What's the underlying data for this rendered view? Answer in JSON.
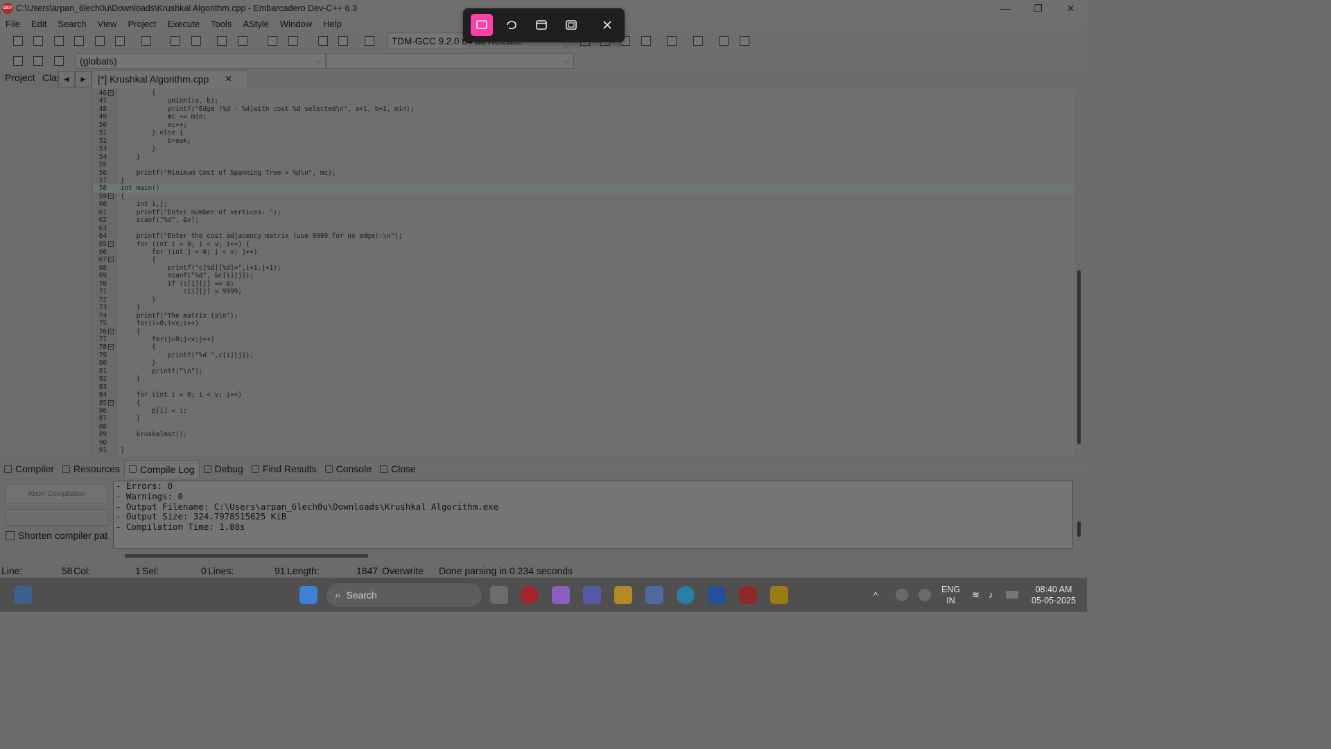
{
  "window": {
    "title": "C:\\Users\\arpan_6lech0u\\Downloads\\Krushkal Algorithm.cpp - Embarcadero Dev-C++ 6.3",
    "logo_text": "DEV",
    "controls": [
      "—",
      "❐",
      "✕"
    ]
  },
  "menu": [
    "File",
    "Edit",
    "Search",
    "View",
    "Project",
    "Execute",
    "Tools",
    "AStyle",
    "Window",
    "Help"
  ],
  "toolbar": {
    "compiler": "TDM-GCC 9.2.0 64-bit Release",
    "scope_combo": "(globals)",
    "function_combo": ""
  },
  "left_tabs": {
    "project": "Project",
    "classes": "Clas"
  },
  "file_tab": {
    "label": "[*] Krushkal Algorithm.cpp",
    "close": "✕"
  },
  "editor": {
    "highlighted_line": 58,
    "lines": [
      {
        "n": "46",
        "text": "        {",
        "fold": "−"
      },
      {
        "n": "47",
        "text": "            union1(a, b);",
        "fold": ""
      },
      {
        "n": "48",
        "text": "            printf(\"Edge (%d - %d)with cost %d selected\\n\", a+1, b+1, min);",
        "fold": ""
      },
      {
        "n": "49",
        "text": "            mc += min;",
        "fold": ""
      },
      {
        "n": "50",
        "text": "            ec++;",
        "fold": ""
      },
      {
        "n": "51",
        "text": "        } else {",
        "fold": ""
      },
      {
        "n": "52",
        "text": "            break;",
        "fold": ""
      },
      {
        "n": "53",
        "text": "        }",
        "fold": ""
      },
      {
        "n": "54",
        "text": "    }",
        "fold": ""
      },
      {
        "n": "55",
        "text": "",
        "fold": ""
      },
      {
        "n": "56",
        "text": "    printf(\"Minimum Cost of Spanning Tree = %d\\n\", mc);",
        "fold": ""
      },
      {
        "n": "57",
        "text": "}",
        "fold": ""
      },
      {
        "n": "58",
        "text": "int main()",
        "fold": ""
      },
      {
        "n": "59",
        "text": "{",
        "fold": "−"
      },
      {
        "n": "60",
        "text": "    int i,j;",
        "fold": ""
      },
      {
        "n": "61",
        "text": "    printf(\"Enter number of vertices: \");",
        "fold": ""
      },
      {
        "n": "62",
        "text": "    scanf(\"%d\", &v);",
        "fold": ""
      },
      {
        "n": "63",
        "text": "",
        "fold": ""
      },
      {
        "n": "64",
        "text": "    printf(\"Enter the cost adjacency matrix (use 9999 for no edge):\\n\");",
        "fold": ""
      },
      {
        "n": "65",
        "text": "    for (int i = 0; i < v; i++) {",
        "fold": "−"
      },
      {
        "n": "66",
        "text": "        for (int j = 0; j < v; j++)",
        "fold": ""
      },
      {
        "n": "67",
        "text": "        {",
        "fold": "−"
      },
      {
        "n": "68",
        "text": "            printf(\"c[%d][%d]=\",i+1,j+1);",
        "fold": ""
      },
      {
        "n": "69",
        "text": "            scanf(\"%d\", &c[i][j]);",
        "fold": ""
      },
      {
        "n": "70",
        "text": "            if (c[i][j] == 0)",
        "fold": ""
      },
      {
        "n": "71",
        "text": "                c[i][j] = 9999;",
        "fold": ""
      },
      {
        "n": "72",
        "text": "        }",
        "fold": ""
      },
      {
        "n": "73",
        "text": "    }",
        "fold": ""
      },
      {
        "n": "74",
        "text": "    printf(\"The matrix is\\n\");",
        "fold": ""
      },
      {
        "n": "75",
        "text": "    for(i=0;i<v;i++)",
        "fold": ""
      },
      {
        "n": "76",
        "text": "    {",
        "fold": "−"
      },
      {
        "n": "77",
        "text": "        for(j=0;j<v;j++)",
        "fold": ""
      },
      {
        "n": "78",
        "text": "        {",
        "fold": "−"
      },
      {
        "n": "79",
        "text": "            printf(\"%d \",c[i][j]);",
        "fold": ""
      },
      {
        "n": "80",
        "text": "        }",
        "fold": ""
      },
      {
        "n": "81",
        "text": "        printf(\"\\n\");",
        "fold": ""
      },
      {
        "n": "82",
        "text": "    }",
        "fold": ""
      },
      {
        "n": "83",
        "text": "",
        "fold": ""
      },
      {
        "n": "84",
        "text": "    for (int i = 0; i < v; i++)",
        "fold": ""
      },
      {
        "n": "85",
        "text": "    {",
        "fold": "−"
      },
      {
        "n": "86",
        "text": "        p[i] = i;",
        "fold": ""
      },
      {
        "n": "87",
        "text": "    }",
        "fold": ""
      },
      {
        "n": "88",
        "text": "",
        "fold": ""
      },
      {
        "n": "89",
        "text": "    kruskalmst();",
        "fold": ""
      },
      {
        "n": "90",
        "text": "",
        "fold": ""
      },
      {
        "n": "91",
        "text": "}",
        "fold": ""
      }
    ]
  },
  "bottom_tabs": [
    "Compiler",
    "Resources",
    "Compile Log",
    "Debug",
    "Find Results",
    "Console",
    "Close"
  ],
  "active_bottom_tab": "Compile Log",
  "compile_panel": {
    "abort_label": "Abort Compilation",
    "shorten_label": "Shorten compiler pat",
    "log": [
      "- Errors: 0",
      "- Warnings: 0",
      "- Output Filename: C:\\Users\\arpan_6lech0u\\Downloads\\Krushkal Algorithm.exe",
      "- Output Size: 324.7978515625 KiB",
      "- Compilation Time: 1.88s"
    ]
  },
  "status": {
    "line_label": "Line:",
    "line_val": "58",
    "col_label": "Col:",
    "col_val": "1",
    "sel_label": "Sel:",
    "sel_val": "0",
    "lines_label": "Lines:",
    "lines_val": "91",
    "length_label": "Length:",
    "length_val": "1847",
    "mode": "Overwrite",
    "message": "Done parsing in 0.234 seconds"
  },
  "taskbar": {
    "search_placeholder": "Search",
    "lang_top": "ENG",
    "lang_bottom": "IN",
    "time": "08:40 AM",
    "date": "05-05-2025"
  },
  "snip_toolbar": {
    "icons": [
      "rectangle-snip-icon",
      "freeform-snip-icon",
      "window-snip-icon",
      "fullscreen-snip-icon",
      "close-icon"
    ],
    "accent": "#ff3fa4"
  }
}
